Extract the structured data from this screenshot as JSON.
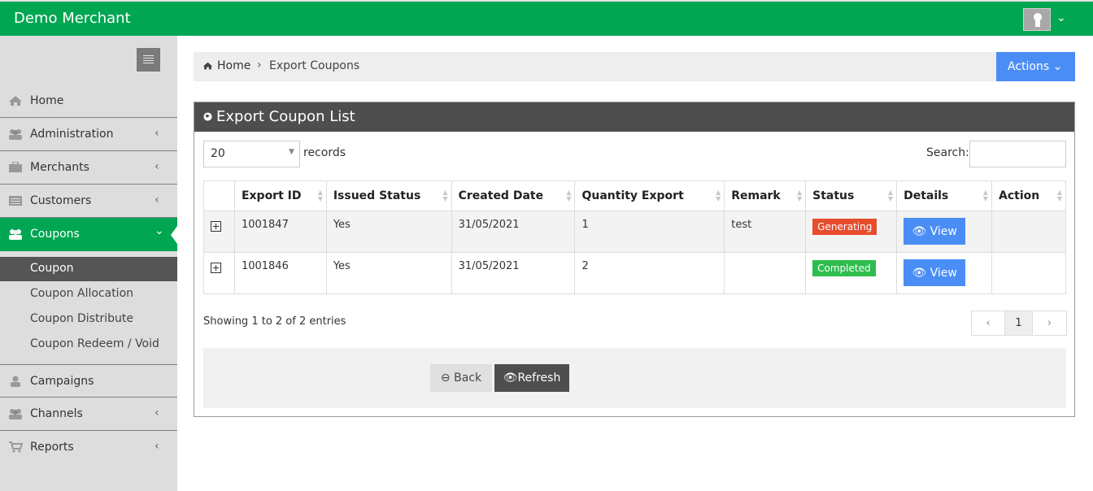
{
  "header": {
    "brand": "Demo Merchant",
    "user_icon": "user-avatar-icon",
    "caret": "⌄"
  },
  "sidebar": {
    "items": [
      {
        "label": "Home",
        "icon": "home-icon",
        "has_children": false
      },
      {
        "label": "Administration",
        "icon": "users-icon",
        "has_children": true
      },
      {
        "label": "Merchants",
        "icon": "briefcase-icon",
        "has_children": true
      },
      {
        "label": "Customers",
        "icon": "list-icon",
        "has_children": true
      },
      {
        "label": "Coupons",
        "icon": "users-icon",
        "has_children": true,
        "active": true
      },
      {
        "label": "Campaigns",
        "icon": "user-icon",
        "has_children": false
      },
      {
        "label": "Channels",
        "icon": "users-icon",
        "has_children": true
      },
      {
        "label": "Reports",
        "icon": "cart-icon",
        "has_children": true
      }
    ],
    "coupon_submenu": [
      "Coupon",
      "Coupon Allocation",
      "Coupon Distribute",
      "Coupon Redeem / Void"
    ],
    "chevron_left": "‹",
    "chevron_down": "⌄"
  },
  "breadcrumb": {
    "home": "Home",
    "separator": "›",
    "current": "Export Coupons"
  },
  "actions_button": "Actions ⌄",
  "panel": {
    "title": "Export Coupon List",
    "length_value": "20",
    "records_label": "records",
    "search_label": "Search:",
    "columns": [
      "",
      "Export ID",
      "Issued Status",
      "Created Date",
      "Quantity Export",
      "Remark",
      "Status",
      "Details",
      "Action"
    ],
    "rows": [
      {
        "export_id": "1001847",
        "issued": "Yes",
        "created": "31/05/2021",
        "qty": "1",
        "remark": "test",
        "status": "Generating",
        "status_kind": "warning",
        "details": "View"
      },
      {
        "export_id": "1001846",
        "issued": "Yes",
        "created": "31/05/2021",
        "qty": "2",
        "remark": "",
        "status": "Completed",
        "status_kind": "success",
        "details": "View"
      }
    ],
    "info": "Showing 1 to 2 of 2 entries",
    "pagination": {
      "prev": "‹",
      "page": "1",
      "next": "›"
    },
    "back_label": "Back",
    "refresh_label": "Refresh"
  },
  "colors": {
    "brand_green": "#00a651",
    "primary_blue": "#4a8ef5",
    "dark_header": "#4e4e4e",
    "badge_red": "#e74c2c",
    "badge_green": "#2ebd4e"
  }
}
